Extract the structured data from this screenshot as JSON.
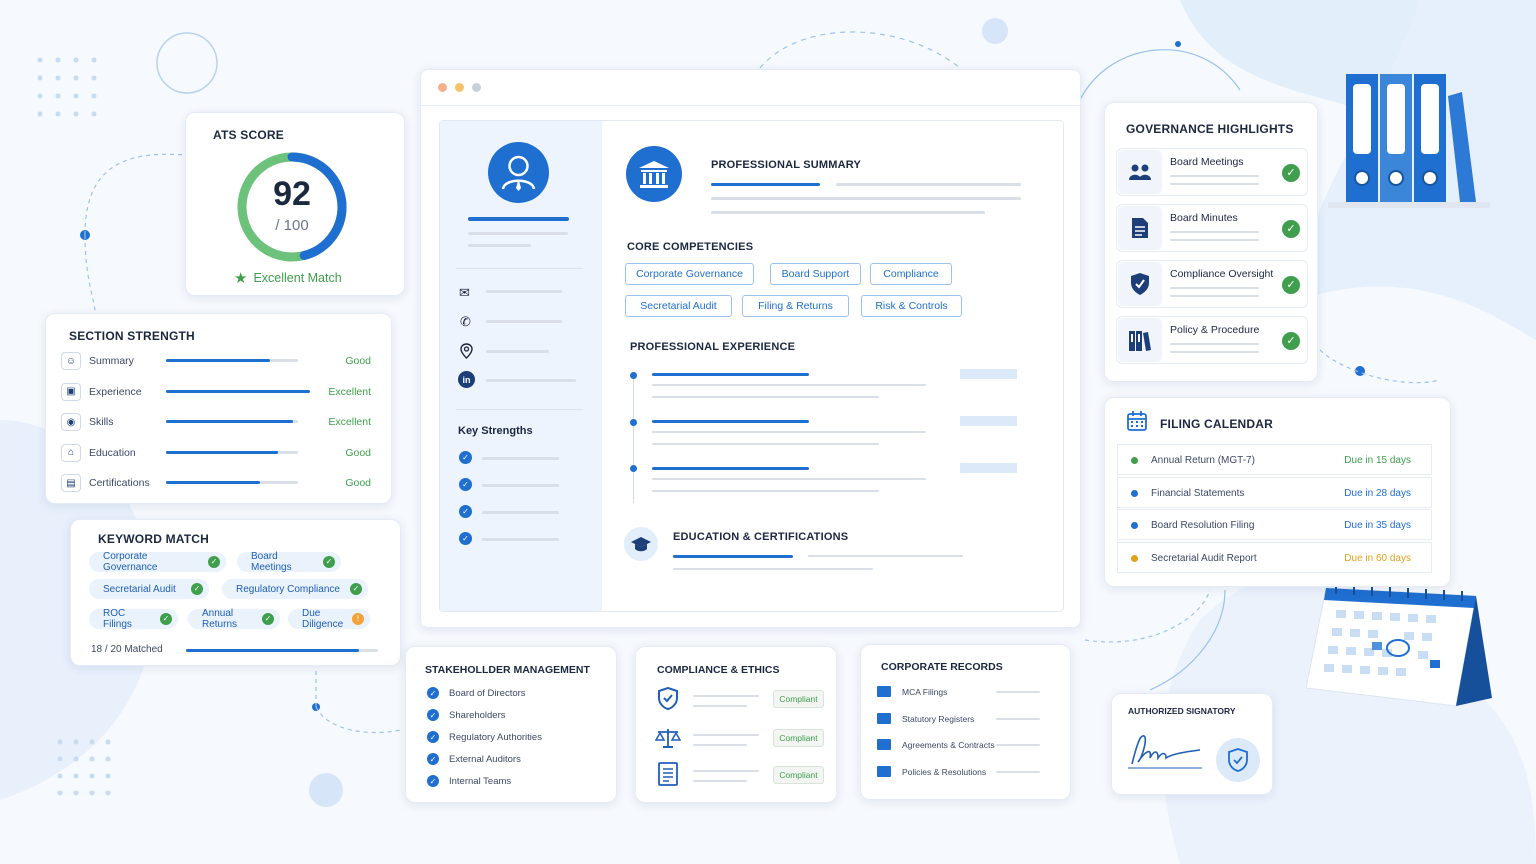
{
  "ats": {
    "title": "ATS SCORE",
    "score": "92",
    "max": "/ 100",
    "match": "Excellent Match",
    "score_fraction": 0.92
  },
  "section_strength": {
    "title": "SECTION STRENGTH",
    "rows": [
      {
        "label": "Summary",
        "rating": "Good",
        "level": 0.72
      },
      {
        "label": "Experience",
        "rating": "Excellent",
        "level": 1.0
      },
      {
        "label": "Skills",
        "rating": "Excellent",
        "level": 0.88
      },
      {
        "label": "Education",
        "rating": "Good",
        "level": 0.78
      },
      {
        "label": "Certifications",
        "rating": "Good",
        "level": 0.65
      }
    ]
  },
  "keyword_match": {
    "title": "KEYWORD MATCH",
    "chips": [
      "Corporate Governance",
      "Board Meetings",
      "Secretarial Audit",
      "Regulatory Compliance",
      "ROC Filings",
      "Annual Returns",
      "Due Diligence"
    ],
    "matched": "18 / 20 Matched",
    "matched_fraction": 0.9
  },
  "resume": {
    "summary_title": "PROFESSIONAL SUMMARY",
    "competencies_title": "CORE COMPETENCIES",
    "competencies": [
      "Corporate Governance",
      "Board Support",
      "Compliance",
      "Secretarial Audit",
      "Filing & Returns",
      "Risk & Controls"
    ],
    "experience_title": "PROFESSIONAL EXPERIENCE",
    "education_title": "EDUCATION & CERTIFICATIONS",
    "key_strengths_title": "Key Strengths"
  },
  "governance": {
    "title": "GOVERNANCE HIGHLIGHTS",
    "items": [
      "Board Meetings",
      "Board Minutes",
      "Compliance Oversight",
      "Policy & Procedure"
    ]
  },
  "filing_calendar": {
    "title": "FILING CALENDAR",
    "rows": [
      {
        "label": "Annual Return (MGT-7)",
        "due": "Due in 15 days",
        "color": "#3f9f4d"
      },
      {
        "label": "Financial Statements",
        "due": "Due in 28 days",
        "color": "#1f6fd1"
      },
      {
        "label": "Board Resolution Filing",
        "due": "Due in 35 days",
        "color": "#1f6fd1"
      },
      {
        "label": "Secretarial Audit Report",
        "due": "Due in 60 days",
        "color": "#e0a21b"
      }
    ]
  },
  "stakeholder": {
    "title": "STAKEHOLLDER MANAGEMENT",
    "items": [
      "Board of Directors",
      "Shareholders",
      "Regulatory Authorities",
      "External Auditors",
      "Internal Teams"
    ]
  },
  "compliance": {
    "title": "COMPLIANCE & ETHICS",
    "badge": "Compliant"
  },
  "records": {
    "title": "CORPORATE RECORDS",
    "items": [
      "MCA Filings",
      "Statutory Registers",
      "Agreements & Contracts",
      "Policies & Resolutions"
    ]
  },
  "signatory": {
    "title": "AUTHORIZED SIGNATORY"
  },
  "colors": {
    "accent": "#1f6fd1",
    "green": "#3f9f4d",
    "orange": "#e0a21b"
  }
}
